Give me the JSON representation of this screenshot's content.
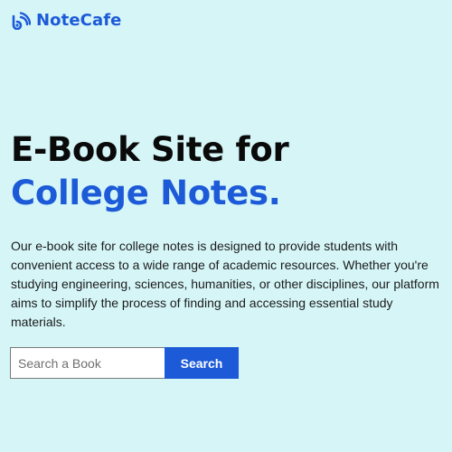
{
  "brand": {
    "name": "NoteCafe",
    "icon": "rss-feed-icon",
    "color": "#1c5ad8"
  },
  "hero": {
    "title_line1": "E-Book Site for",
    "title_line2": "College Notes.",
    "description": "Our e-book site for college notes is designed to provide students with convenient access to a wide range of academic resources. Whether you're studying engineering, sciences, humanities, or other disciplines, our platform aims to simplify the process of finding and accessing essential study materials."
  },
  "search": {
    "placeholder": "Search a Book",
    "value": "",
    "button_label": "Search"
  },
  "colors": {
    "background": "#d5f5f7",
    "accent": "#1c5ad8",
    "text": "#0a0a0a"
  }
}
